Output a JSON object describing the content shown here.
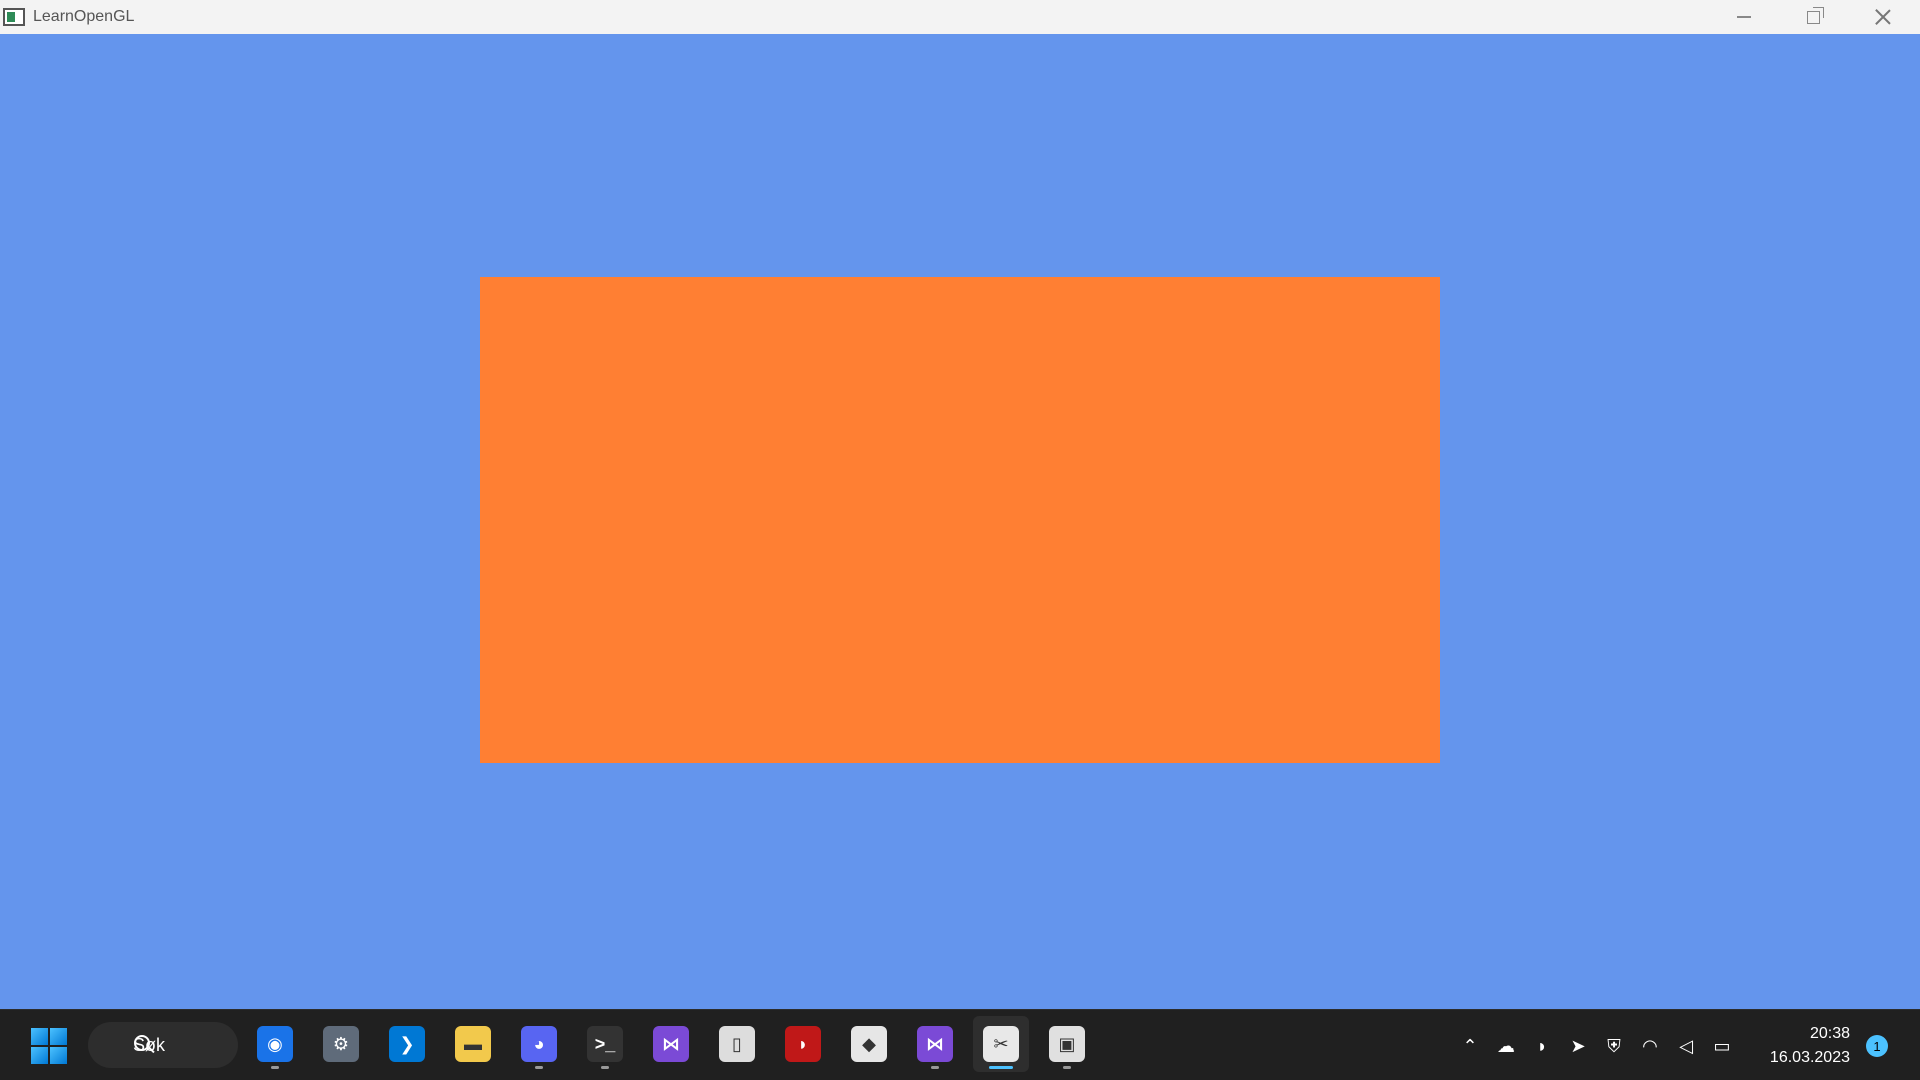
{
  "window": {
    "title": "LearnOpenGL",
    "icon": "window-app-icon",
    "clear_color": "#6495ED",
    "rect_color": "#FF7F33"
  },
  "taskbar": {
    "search_label": "Søk",
    "apps": [
      {
        "name": "chrome-dev",
        "icon": "chrome-dev-icon",
        "color": "#1a73e8",
        "glyph": "◉",
        "running": true,
        "active": false
      },
      {
        "name": "settings",
        "icon": "gear-icon",
        "color": "#5f6b7a",
        "glyph": "⚙",
        "running": false,
        "active": false
      },
      {
        "name": "vscode",
        "icon": "vscode-icon",
        "color": "#0078d4",
        "glyph": "❯",
        "running": false,
        "active": false
      },
      {
        "name": "file-explorer",
        "icon": "folder-icon",
        "color": "#f2c94c",
        "glyph": "▬",
        "running": false,
        "active": false
      },
      {
        "name": "discord",
        "icon": "discord-icon",
        "color": "#5865f2",
        "glyph": "◕",
        "running": true,
        "active": false
      },
      {
        "name": "terminal",
        "icon": "terminal-icon",
        "color": "#333333",
        "glyph": ">_",
        "running": true,
        "active": false
      },
      {
        "name": "visual-studio",
        "icon": "visual-studio-icon",
        "color": "#7b4ad6",
        "glyph": "⋈",
        "running": false,
        "active": false
      },
      {
        "name": "app-square",
        "icon": "app-square-icon",
        "color": "#dddddd",
        "glyph": "▯",
        "running": false,
        "active": false
      },
      {
        "name": "mcafee",
        "icon": "mcafee-icon",
        "color": "#c01818",
        "glyph": "◗",
        "running": false,
        "active": false
      },
      {
        "name": "roblox",
        "icon": "roblox-icon",
        "color": "#e6e6e6",
        "glyph": "◆",
        "running": false,
        "active": false
      },
      {
        "name": "visual-studio-2",
        "icon": "visual-studio-icon",
        "color": "#7b4ad6",
        "glyph": "⋈",
        "running": true,
        "active": false
      },
      {
        "name": "snipping-tool",
        "icon": "snipping-tool-icon",
        "color": "#e8e8e8",
        "glyph": "✂",
        "running": true,
        "active": true
      },
      {
        "name": "learnopengl",
        "icon": "window-app-icon",
        "color": "#e0e0e0",
        "glyph": "▣",
        "running": true,
        "active": false
      }
    ]
  },
  "tray": {
    "icons": [
      "chevron-up-icon",
      "cloud-icon",
      "mcafee-icon",
      "arrow-icon",
      "shield-icon",
      "wifi-icon",
      "volume-icon",
      "battery-icon"
    ],
    "glyphs": [
      "⌃",
      "☁",
      "◗",
      "➤",
      "⛨",
      "◠",
      "◁",
      "▭"
    ],
    "time": "20:38",
    "date": "16.03.2023",
    "notification_count": "1"
  }
}
